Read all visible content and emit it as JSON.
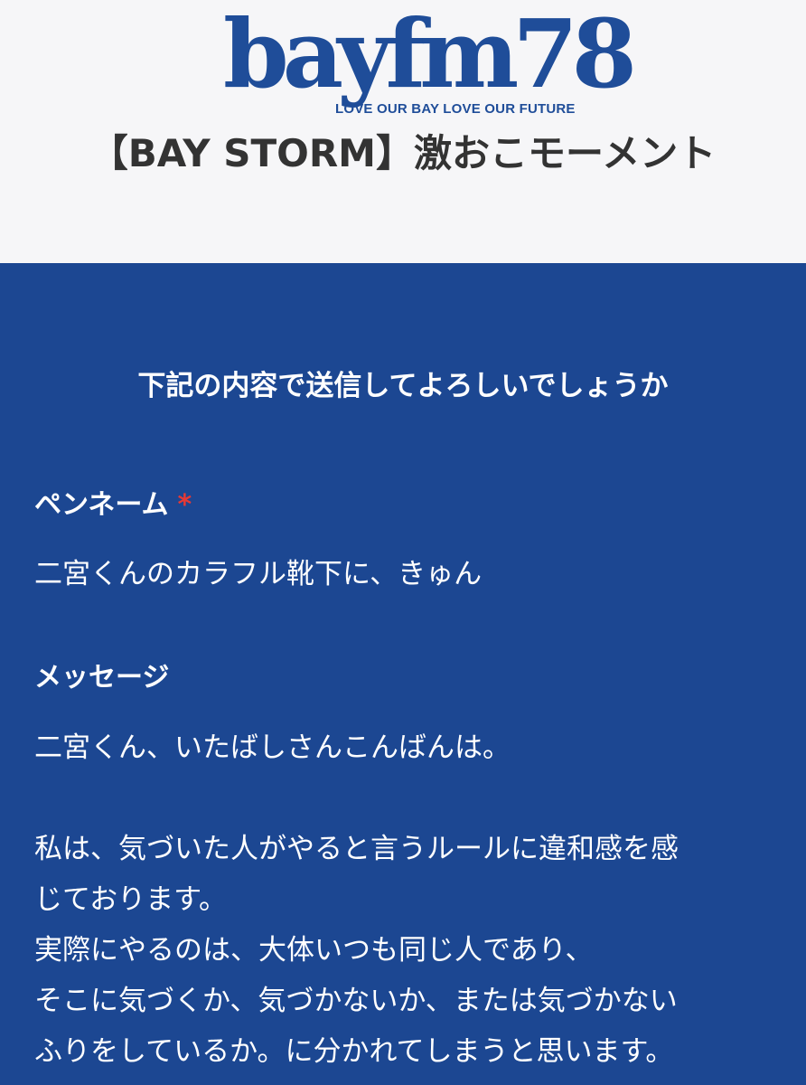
{
  "header": {
    "logo_text": "bayfm78",
    "logo_tagline": "LOVE OUR BAY  LOVE OUR FUTURE",
    "title": "【BAY STORM】激おこモーメント"
  },
  "form": {
    "confirm_heading": "下記の内容で送信してよろしいでしょうか",
    "penname": {
      "label": "ペンネーム",
      "required_mark": "*",
      "value": "二宮くんのカラフル靴下に、きゅん"
    },
    "message": {
      "label": "メッセージ",
      "lines": [
        "二宮くん、いたばしさんこんばんは。",
        "",
        "私は、気づいた人がやると言うルールに違和感を感",
        "じております。",
        "実際にやるのは、大体いつも同じ人であり、",
        "そこに気づくか、気づかないか、または気づかない",
        "ふりをしているか。に分かれてしまうと思います。"
      ]
    }
  },
  "colors": {
    "header_bg": "#f6f6f8",
    "panel_bg": "#1c4792",
    "brand_blue": "#1f4d99",
    "required_red": "#e53935",
    "title_text": "#333333"
  }
}
